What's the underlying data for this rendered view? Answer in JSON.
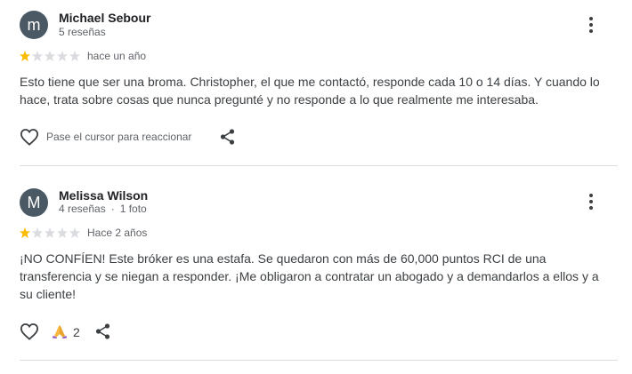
{
  "reviews": [
    {
      "avatar_letter": "m",
      "name": "Michael Sebour",
      "meta": "5 reseñas",
      "rating": 1,
      "time": "hace un año",
      "text": "Esto tiene que ser una broma. Christopher, el que me contactó, responde cada 10 o 14 días. Y cuando lo hace, trata sobre cosas que nunca pregunté y no responde a lo que realmente me interesaba.",
      "react_label": "Pase el cursor para reaccionar"
    },
    {
      "avatar_letter": "M",
      "name": "Melissa Wilson",
      "meta_reviews": "4 reseñas",
      "meta_separator": "·",
      "meta_photos": "1 foto",
      "rating": 1,
      "time": "Hace 2 años",
      "text": "¡NO CONFÍEN! Este bróker es una estafa. Se quedaron con más de 60,000 puntos RCI de una transferencia y se niegan a responder. ¡Me obligaron a contratar un abogado y a demandarlos a ellos y a su cliente!",
      "reaction_emoji": "folded-hands",
      "reaction_count": "2"
    }
  ],
  "colors": {
    "star_filled": "#fbbc04",
    "star_empty": "#dadce0",
    "avatar": "#4a5963"
  }
}
